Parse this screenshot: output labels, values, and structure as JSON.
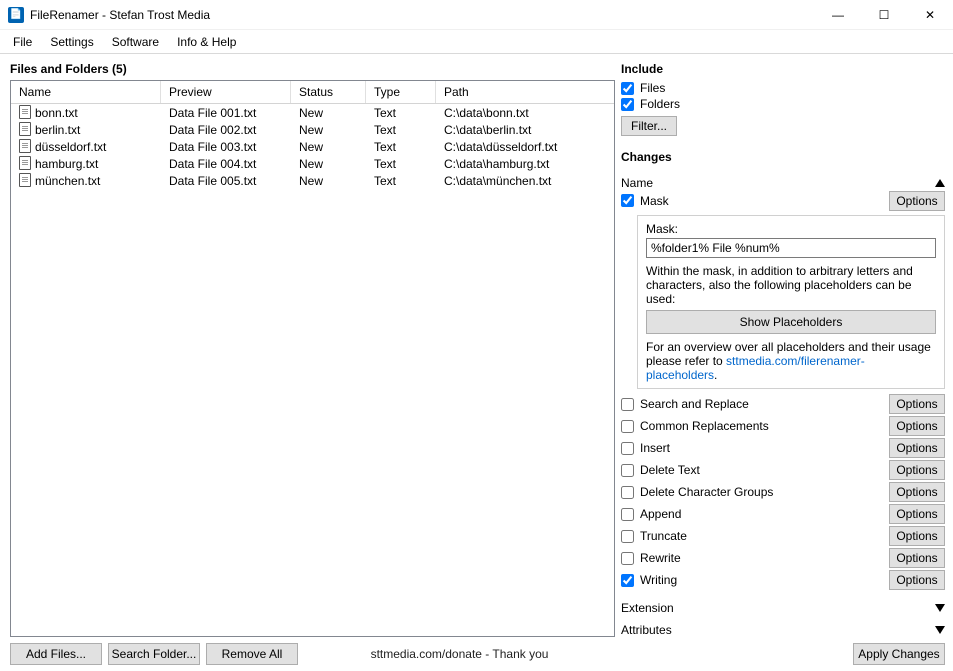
{
  "window": {
    "title": "FileRenamer - Stefan Trost Media",
    "controls": {
      "min": "—",
      "max": "☐",
      "close": "✕"
    }
  },
  "menu": [
    "File",
    "Settings",
    "Software",
    "Info & Help"
  ],
  "left": {
    "header": "Files and Folders (5)",
    "cols": {
      "name": "Name",
      "preview": "Preview",
      "status": "Status",
      "type": "Type",
      "path": "Path"
    },
    "rows": [
      {
        "name": "bonn.txt",
        "preview": "Data File 001.txt",
        "status": "New",
        "type": "Text",
        "path": "C:\\data\\bonn.txt"
      },
      {
        "name": "berlin.txt",
        "preview": "Data File 002.txt",
        "status": "New",
        "type": "Text",
        "path": "C:\\data\\berlin.txt"
      },
      {
        "name": "düsseldorf.txt",
        "preview": "Data File 003.txt",
        "status": "New",
        "type": "Text",
        "path": "C:\\data\\düsseldorf.txt"
      },
      {
        "name": "hamburg.txt",
        "preview": "Data File 004.txt",
        "status": "New",
        "type": "Text",
        "path": "C:\\data\\hamburg.txt"
      },
      {
        "name": "münchen.txt",
        "preview": "Data File 005.txt",
        "status": "New",
        "type": "Text",
        "path": "C:\\data\\münchen.txt"
      }
    ],
    "buttons": {
      "add": "Add Files...",
      "search": "Search Folder...",
      "remove": "Remove All"
    },
    "status": "sttmedia.com/donate - Thank you"
  },
  "right": {
    "include": {
      "title": "Include",
      "files": "Files",
      "folders": "Folders",
      "filter": "Filter..."
    },
    "changes": {
      "title": "Changes",
      "name": "Name",
      "mask": {
        "label": "Mask",
        "options": "Options",
        "field_label": "Mask:",
        "value": "%folder1% File %num%",
        "desc": "Within the mask, in addition to arbitrary letters and characters, also the following placeholders can be used:",
        "show": "Show Placeholders",
        "desc2_a": "For an overview over all placeholders and their usage please refer to ",
        "desc2_link": "sttmedia.com/filerenamer-placeholders",
        "desc2_b": "."
      },
      "items": [
        {
          "label": "Search and Replace",
          "checked": false
        },
        {
          "label": "Common Replacements",
          "checked": false
        },
        {
          "label": "Insert",
          "checked": false
        },
        {
          "label": "Delete Text",
          "checked": false
        },
        {
          "label": "Delete Character Groups",
          "checked": false
        },
        {
          "label": "Append",
          "checked": false
        },
        {
          "label": "Truncate",
          "checked": false
        },
        {
          "label": "Rewrite",
          "checked": false
        },
        {
          "label": "Writing",
          "checked": true
        }
      ],
      "options": "Options",
      "extension": "Extension",
      "attributes": "Attributes"
    },
    "apply": "Apply Changes"
  }
}
